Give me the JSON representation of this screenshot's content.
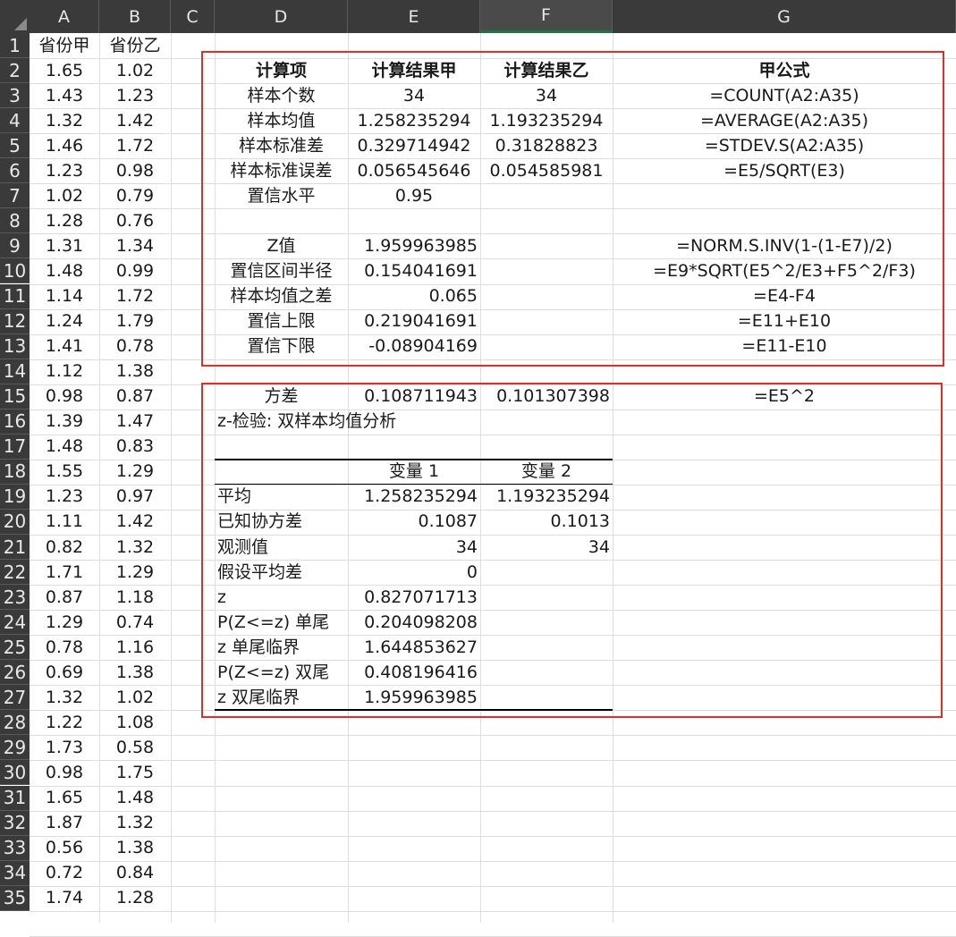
{
  "columns": [
    "A",
    "B",
    "C",
    "D",
    "E",
    "F",
    "G"
  ],
  "rows": [
    "1",
    "2",
    "3",
    "4",
    "5",
    "6",
    "7",
    "8",
    "9",
    "10",
    "11",
    "12",
    "13",
    "14",
    "15",
    "16",
    "17",
    "18",
    "19",
    "20",
    "21",
    "22",
    "23",
    "24",
    "25",
    "26",
    "27",
    "28",
    "29",
    "30",
    "31",
    "32",
    "33",
    "34",
    "35"
  ],
  "colA": {
    "header": "省份甲",
    "values": [
      "1.65",
      "1.43",
      "1.32",
      "1.46",
      "1.23",
      "1.02",
      "1.28",
      "1.31",
      "1.48",
      "1.14",
      "1.24",
      "1.41",
      "1.12",
      "0.98",
      "1.39",
      "1.48",
      "1.55",
      "1.23",
      "1.11",
      "0.82",
      "1.71",
      "0.87",
      "1.29",
      "0.78",
      "0.69",
      "1.32",
      "1.22",
      "1.73",
      "0.98",
      "1.65",
      "1.87",
      "0.56",
      "0.72",
      "1.74"
    ]
  },
  "colB": {
    "header": "省份乙",
    "values": [
      "1.02",
      "1.23",
      "1.42",
      "1.72",
      "0.98",
      "0.79",
      "0.76",
      "1.34",
      "0.99",
      "1.72",
      "1.79",
      "0.78",
      "1.38",
      "0.87",
      "1.47",
      "0.83",
      "1.29",
      "0.97",
      "1.42",
      "1.32",
      "1.29",
      "1.18",
      "0.74",
      "1.16",
      "1.38",
      "1.02",
      "1.08",
      "0.58",
      "1.75",
      "1.48",
      "1.32",
      "1.38",
      "0.84",
      "1.28"
    ]
  },
  "calc_table": {
    "headers": [
      "计算项",
      "计算结果甲",
      "计算结果乙",
      "甲公式"
    ],
    "rows": [
      {
        "item": "样本个数",
        "e": "34",
        "f": "34",
        "g": "=COUNT(A2:A35)"
      },
      {
        "item": "样本均值",
        "e": "1.258235294",
        "f": "1.193235294",
        "g": "=AVERAGE(A2:A35)"
      },
      {
        "item": "样本标准差",
        "e": "0.329714942",
        "f": "0.31828823",
        "g": "=STDEV.S(A2:A35)"
      },
      {
        "item": "样本标准误差",
        "e": "0.056545646",
        "f": "0.054585981",
        "g": "=E5/SQRT(E3)"
      },
      {
        "item": "置信水平",
        "e": "0.95",
        "f": "",
        "g": ""
      },
      {
        "item": "",
        "e": "",
        "f": "",
        "g": ""
      },
      {
        "item": "Z值",
        "e": "1.959963985",
        "f": "",
        "g": "=NORM.S.INV(1-(1-E7)/2)"
      },
      {
        "item": "置信区间半径",
        "e": "0.154041691",
        "f": "",
        "g": "=E9*SQRT(E5^2/E3+F5^2/F3)"
      },
      {
        "item": "样本均值之差",
        "e": "0.065",
        "f": "",
        "g": "=E4-F4"
      },
      {
        "item": "置信上限",
        "e": "0.219041691",
        "f": "",
        "g": "=E11+E10"
      },
      {
        "item": "置信下限",
        "e": "-0.08904169",
        "f": "",
        "g": "=E11-E10"
      }
    ]
  },
  "variance_row": {
    "item": "方差",
    "e": "0.108711943",
    "f": "0.101307398",
    "g": "=E5^2"
  },
  "ztest": {
    "title": "z-检验: 双样本均值分析",
    "headers": [
      "",
      "变量 1",
      "变量 2"
    ],
    "rows": [
      {
        "label": "平均",
        "v1": "1.258235294",
        "v2": "1.193235294"
      },
      {
        "label": "已知协方差",
        "v1": "0.1087",
        "v2": "0.1013"
      },
      {
        "label": "观测值",
        "v1": "34",
        "v2": "34"
      },
      {
        "label": "假设平均差",
        "v1": "0",
        "v2": ""
      },
      {
        "label": "z",
        "v1": "0.827071713",
        "v2": ""
      },
      {
        "label": "P(Z<=z) 单尾",
        "v1": "0.204098208",
        "v2": ""
      },
      {
        "label": "z 单尾临界",
        "v1": "1.644853627",
        "v2": ""
      },
      {
        "label": "P(Z<=z) 双尾",
        "v1": "0.408196416",
        "v2": ""
      },
      {
        "label": "z 双尾临界",
        "v1": "1.959963985",
        "v2": ""
      }
    ]
  },
  "colors": {
    "header_bg": "#3a3a3a",
    "highlight_box": "#d9302c",
    "selected_col": "#217346"
  }
}
